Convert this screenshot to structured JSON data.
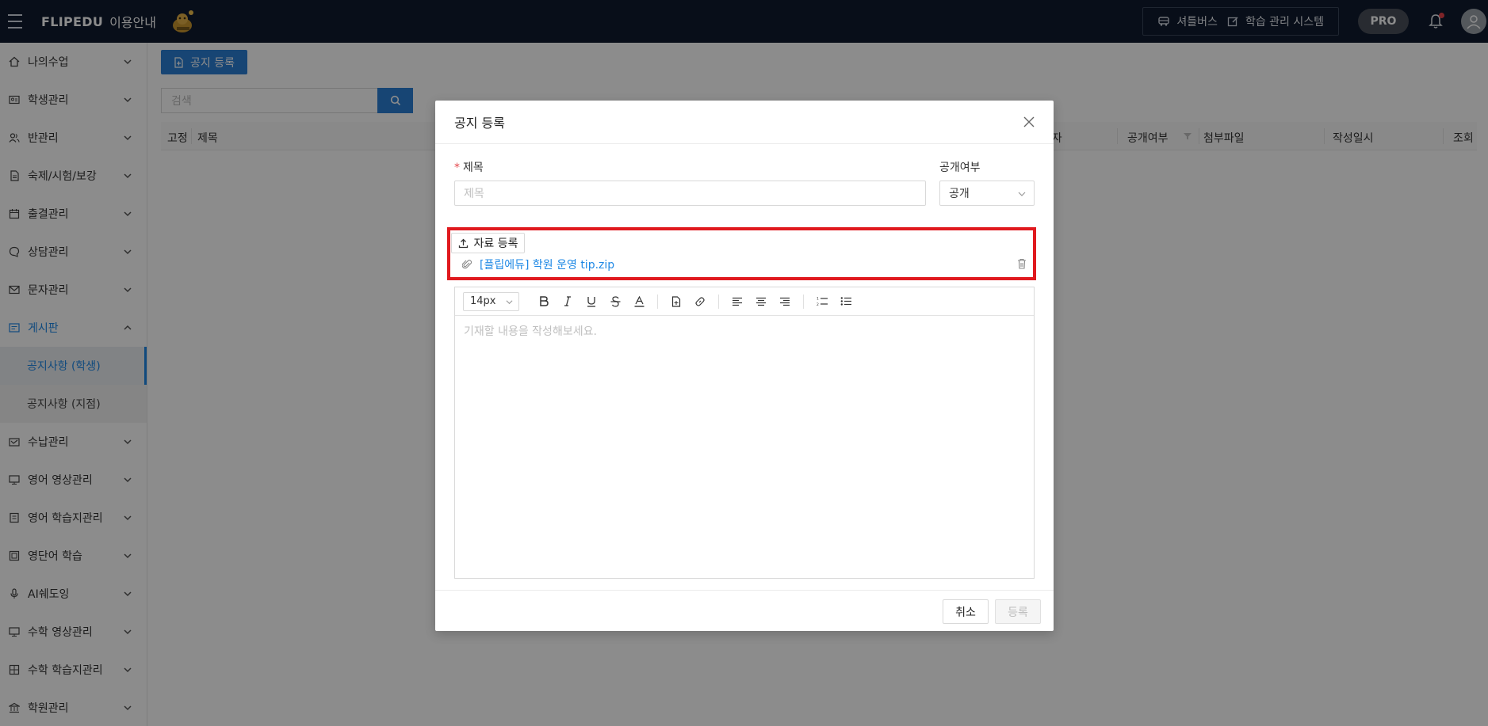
{
  "topbar": {
    "brand": "FLIPEDU",
    "brand_sub": "이용안내",
    "links": [
      {
        "label": "셔틀버스",
        "icon": "bus-icon"
      },
      {
        "label": "학습 관리 시스템",
        "icon": "edit-icon"
      }
    ],
    "pro_label": "PRO"
  },
  "sidebar": {
    "items": [
      {
        "label": "나의수업",
        "icon": "home-icon"
      },
      {
        "label": "학생관리",
        "icon": "id-card-icon"
      },
      {
        "label": "반관리",
        "icon": "users-icon"
      },
      {
        "label": "숙제/시험/보강",
        "icon": "file-icon"
      },
      {
        "label": "출결관리",
        "icon": "calendar-icon"
      },
      {
        "label": "상담관리",
        "icon": "chat-icon"
      },
      {
        "label": "문자관리",
        "icon": "mail-icon"
      },
      {
        "label": "게시판",
        "icon": "board-icon"
      },
      {
        "label": "수납관리",
        "icon": "wallet-icon"
      },
      {
        "label": "영어 영상관리",
        "icon": "monitor-icon"
      },
      {
        "label": "영어 학습지관리",
        "icon": "book-icon"
      },
      {
        "label": "영단어 학습",
        "icon": "vocab-icon"
      },
      {
        "label": "AI쉐도잉",
        "icon": "mic-icon"
      },
      {
        "label": "수학 영상관리",
        "icon": "monitor-icon"
      },
      {
        "label": "수학 학습지관리",
        "icon": "grid-icon"
      },
      {
        "label": "학원관리",
        "icon": "bank-icon"
      }
    ],
    "sub_items": [
      {
        "label": "공지사항 (학생)"
      },
      {
        "label": "공지사항 (지점)"
      }
    ]
  },
  "main": {
    "add_notice_label": "공지 등록",
    "search_placeholder": "검색",
    "columns": [
      "고정",
      "제목",
      "작성자",
      "공개여부",
      "첨부파일",
      "작성일시",
      "조회"
    ]
  },
  "modal": {
    "title": "공지 등록",
    "title_label": "제목",
    "title_placeholder": "제목",
    "public_label": "공개여부",
    "public_value": "공개",
    "upload_label": "자료 등록",
    "file_name": "[플립에듀] 학원 운영 tip.zip",
    "font_size": "14px",
    "editor_placeholder": "기재할 내용을 작성해보세요.",
    "cancel_label": "취소",
    "submit_label": "등록",
    "highlight_color": "#e0191e"
  },
  "colors": {
    "accent": "#1e88e5",
    "topbar": "#0f1a2e"
  }
}
